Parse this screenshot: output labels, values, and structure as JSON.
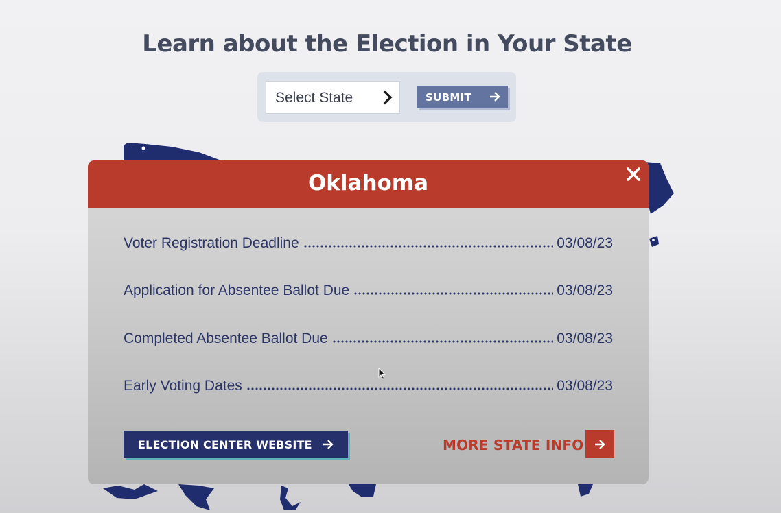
{
  "page": {
    "heading": "Learn about the Election in Your State"
  },
  "selector": {
    "placeholder": "Select State",
    "chevron_icon": "chevron-right-icon",
    "submit_label": "SUBMIT",
    "submit_icon": "arrow-right-icon"
  },
  "modal": {
    "title": "Oklahoma",
    "close_icon": "close-icon",
    "deadlines": [
      {
        "label": "Voter Registration Deadline",
        "date": "03/08/23"
      },
      {
        "label": "Application for Absentee Ballot Due",
        "date": "03/08/23"
      },
      {
        "label": "Completed Absentee Ballot Due",
        "date": "03/08/23"
      },
      {
        "label": "Early Voting Dates",
        "date": "03/08/23"
      }
    ],
    "election_center_label": "ELECTION CENTER WEBSITE",
    "more_info_label": "MORE STATE INFO"
  },
  "colors": {
    "accent_red": "#b93b2c",
    "navy": "#26306a",
    "heading_gray": "#454b5f",
    "submit_blue": "#6474a0",
    "map_navy": "#1f2d6e"
  }
}
